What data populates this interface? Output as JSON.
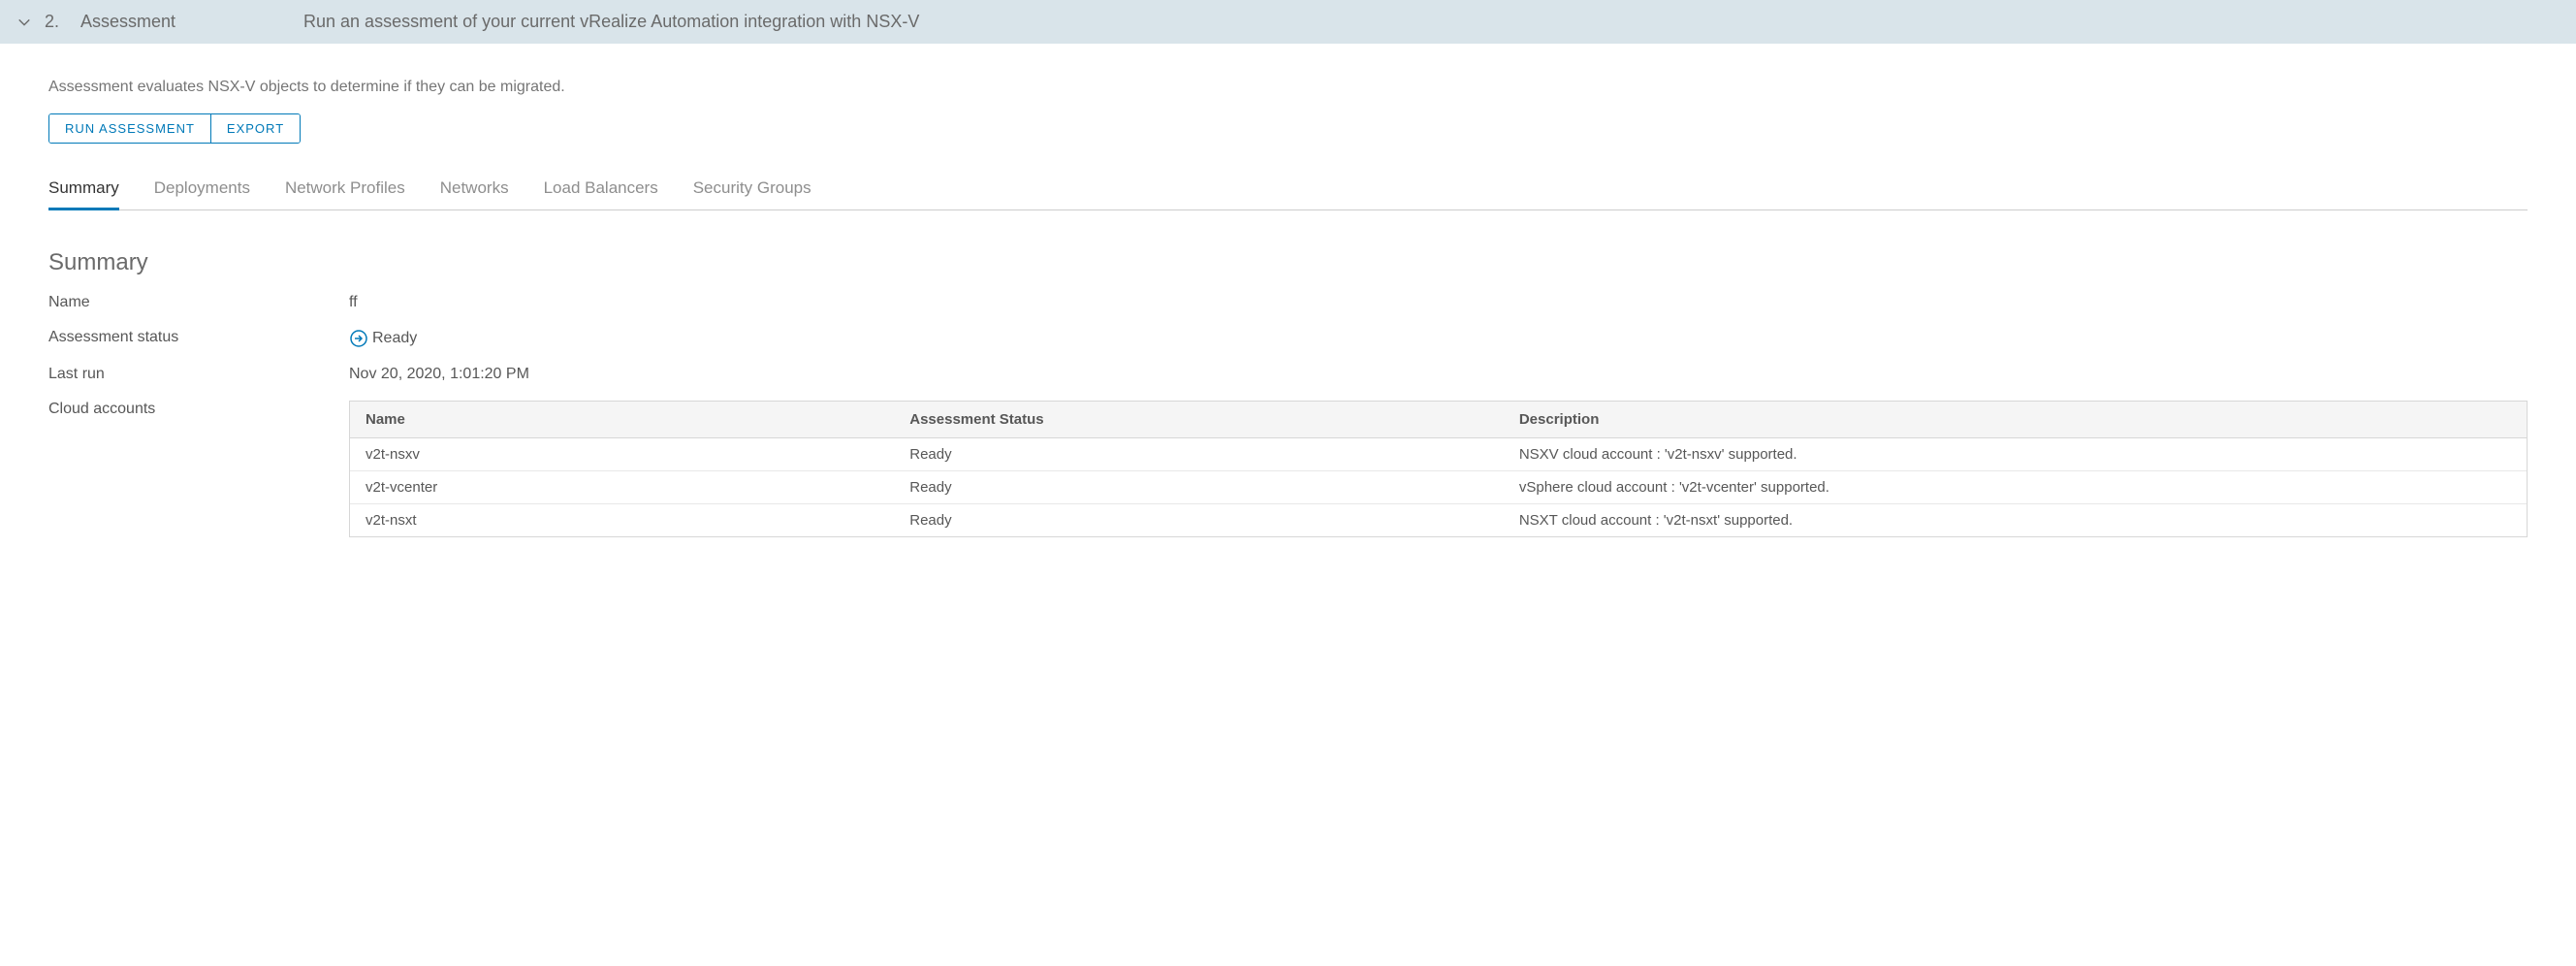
{
  "header": {
    "step_number": "2.",
    "step_title": "Assessment",
    "step_description": "Run an assessment of your current vRealize Automation integration with NSX-V"
  },
  "intro": "Assessment evaluates NSX-V objects to determine if they can be migrated.",
  "buttons": {
    "run_assessment": "RUN ASSESSMENT",
    "export": "EXPORT"
  },
  "tabs": [
    {
      "id": "summary",
      "label": "Summary",
      "active": true
    },
    {
      "id": "deployments",
      "label": "Deployments",
      "active": false
    },
    {
      "id": "network-profiles",
      "label": "Network Profiles",
      "active": false
    },
    {
      "id": "networks",
      "label": "Networks",
      "active": false
    },
    {
      "id": "load-balancers",
      "label": "Load Balancers",
      "active": false
    },
    {
      "id": "security-groups",
      "label": "Security Groups",
      "active": false
    }
  ],
  "summary": {
    "heading": "Summary",
    "labels": {
      "name": "Name",
      "status": "Assessment status",
      "last_run": "Last run",
      "cloud_accounts": "Cloud accounts"
    },
    "name_value": "ff",
    "status_value": "Ready",
    "last_run_value": "Nov 20, 2020, 1:01:20 PM"
  },
  "accounts_table": {
    "columns": {
      "name": "Name",
      "status": "Assessment Status",
      "description": "Description"
    },
    "rows": [
      {
        "name": "v2t-nsxv",
        "status": "Ready",
        "description": "NSXV cloud account : 'v2t-nsxv' supported."
      },
      {
        "name": "v2t-vcenter",
        "status": "Ready",
        "description": "vSphere cloud account : 'v2t-vcenter' supported."
      },
      {
        "name": "v2t-nsxt",
        "status": "Ready",
        "description": "NSXT cloud account : 'v2t-nsxt' supported."
      }
    ]
  }
}
